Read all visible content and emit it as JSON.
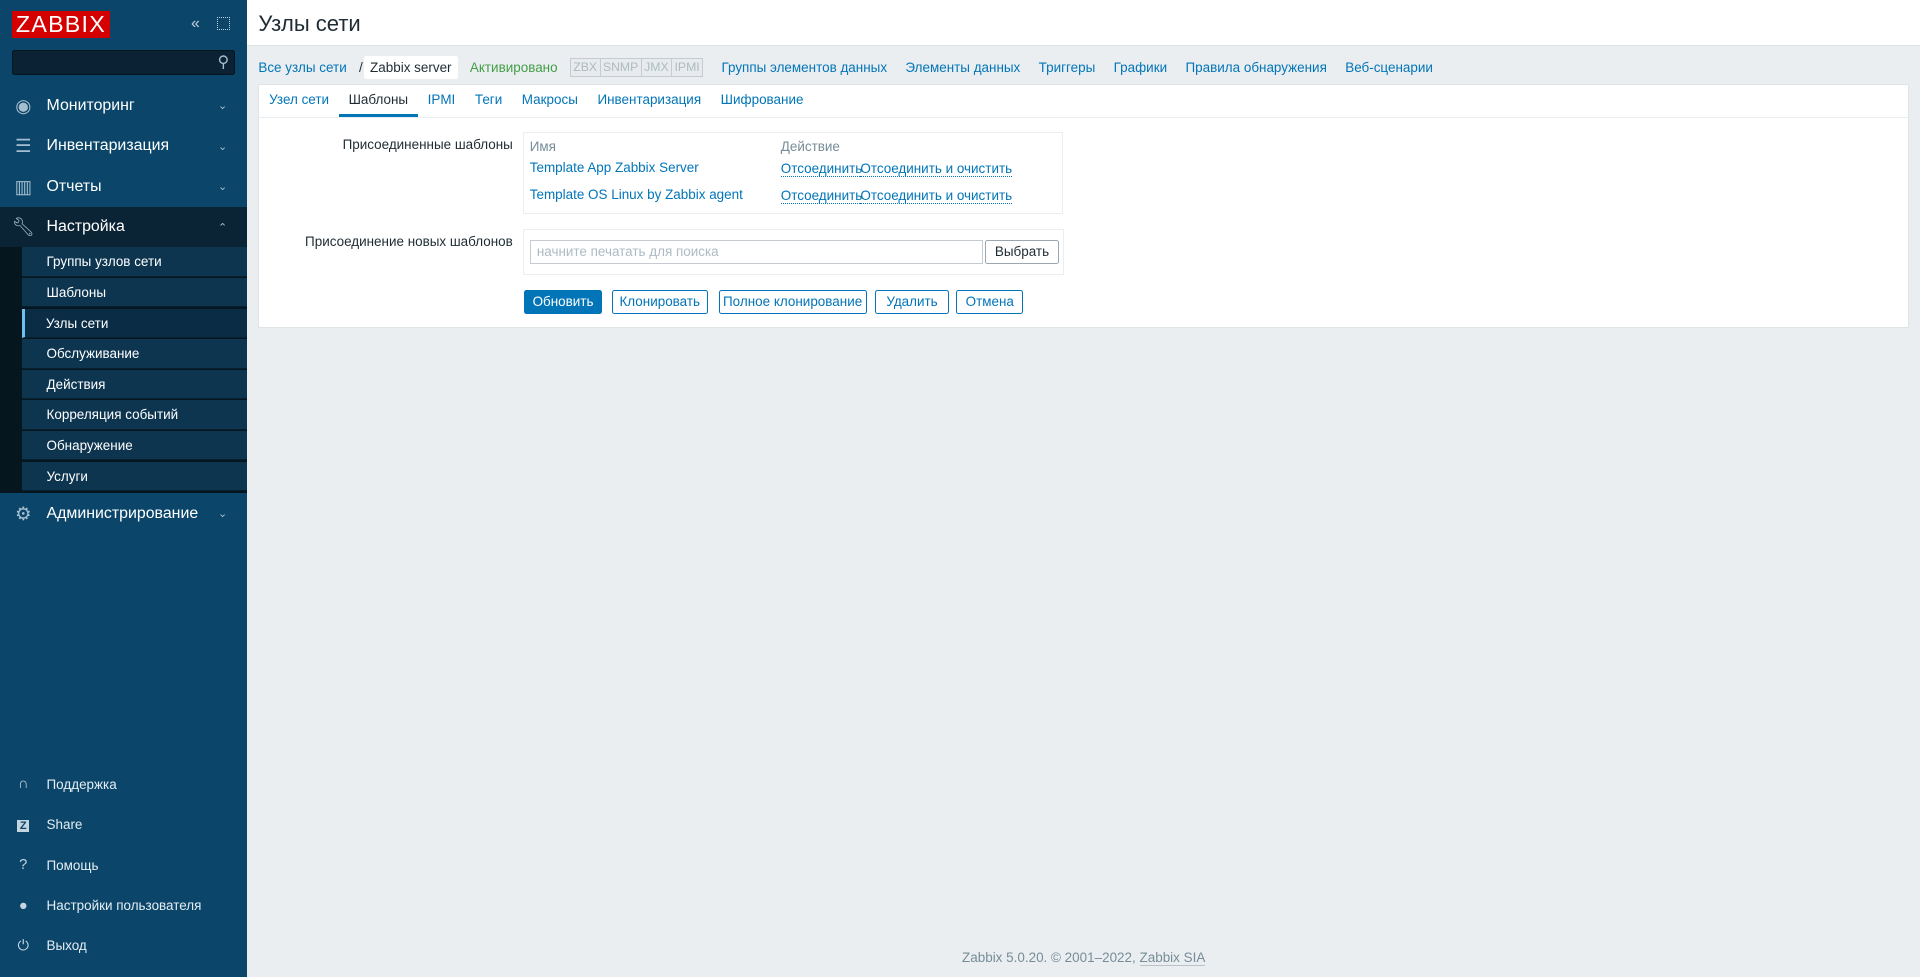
{
  "sidebar": {
    "logo": "ZABBIX",
    "search_placeholder": "",
    "menu": [
      {
        "label": "Мониторинг",
        "icon": "eye-icon"
      },
      {
        "label": "Инвентаризация",
        "icon": "list-icon"
      },
      {
        "label": "Отчеты",
        "icon": "bar-chart-icon"
      },
      {
        "label": "Настройка",
        "icon": "wrench-icon"
      },
      {
        "label": "Администрирование",
        "icon": "gear-icon"
      }
    ],
    "submenu": [
      "Группы узлов сети",
      "Шаблоны",
      "Узлы сети",
      "Обслуживание",
      "Действия",
      "Корреляция событий",
      "Обнаружение",
      "Услуги"
    ],
    "bottom": [
      {
        "label": "Поддержка",
        "icon": "headset-icon"
      },
      {
        "label": "Share",
        "icon": "share-z-icon"
      },
      {
        "label": "Помощь",
        "icon": "help-icon"
      },
      {
        "label": "Настройки пользователя",
        "icon": "user-icon"
      },
      {
        "label": "Выход",
        "icon": "power-icon"
      }
    ]
  },
  "header": {
    "title": "Узлы сети"
  },
  "breadcrumb": {
    "all_hosts": "Все узлы сети",
    "separator": "/",
    "host": "Zabbix server",
    "status": "Активировано",
    "interfaces": [
      "ZBX",
      "SNMP",
      "JMX",
      "IPMI"
    ],
    "links": [
      "Группы элементов данных",
      "Элементы данных",
      "Триггеры",
      "Графики",
      "Правила обнаружения",
      "Веб-сценарии"
    ]
  },
  "tabs": [
    "Узел сети",
    "Шаблоны",
    "IPMI",
    "Теги",
    "Макросы",
    "Инвентаризация",
    "Шифрование"
  ],
  "form": {
    "linked_label": "Присоединенные шаблоны",
    "col_name": "Имя",
    "col_action": "Действие",
    "templates": [
      {
        "name": "Template App Zabbix Server",
        "unlink": "Отсоединить",
        "unlink_clear": "Отсоединить и очистить"
      },
      {
        "name": "Template OS Linux by Zabbix agent",
        "unlink": "Отсоединить",
        "unlink_clear": "Отсоединить и очистить"
      }
    ],
    "new_label": "Присоединение новых шаблонов",
    "search_placeholder": "начните печатать для поиска",
    "select_button": "Выбрать"
  },
  "buttons": {
    "update": "Обновить",
    "clone": "Клонировать",
    "full_clone": "Полное клонирование",
    "delete": "Удалить",
    "cancel": "Отмена"
  },
  "footer": {
    "text": "Zabbix 5.0.20. © 2001–2022,",
    "link": "Zabbix SIA"
  }
}
